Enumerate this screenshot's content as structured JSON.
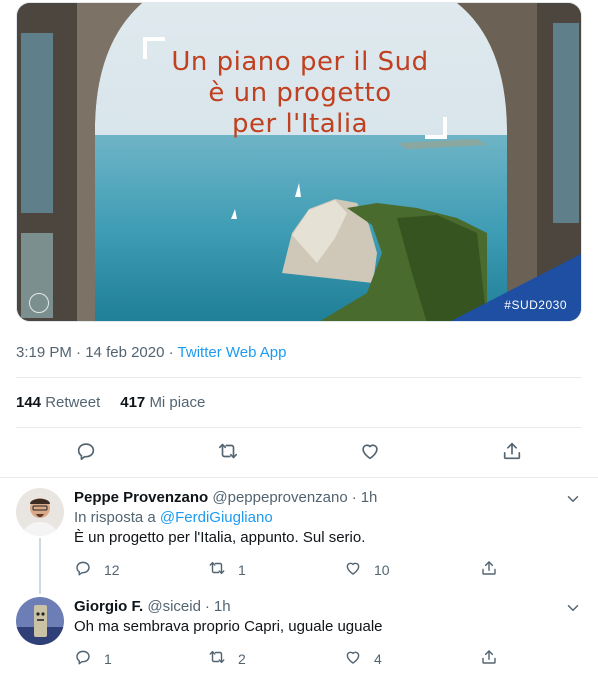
{
  "media": {
    "headline": [
      "Un piano per il Sud",
      "è un progetto",
      "per l'Italia"
    ],
    "hashtag": "#SUD2030"
  },
  "tweet": {
    "time": "3:19 PM",
    "dot": "·",
    "date": "14 feb 2020",
    "source": "Twitter Web App",
    "retweets": "144",
    "retweets_label": "Retweet",
    "likes": "417",
    "likes_label": "Mi piace"
  },
  "replies": [
    {
      "name": "Peppe Provenzano",
      "handle": "@peppeprovenzano",
      "dot": "·",
      "time": "1h",
      "in_reply_prefix": "In risposta a",
      "in_reply_mention": "@FerdiGiugliano",
      "text": "È un progetto per l'Italia, appunto. Sul serio.",
      "reply_count": "12",
      "retweet_count": "1",
      "like_count": "10"
    },
    {
      "name": "Giorgio F.",
      "handle": "@siceid",
      "dot": "·",
      "time": "1h",
      "text": "Oh ma sembrava proprio Capri, uguale uguale",
      "reply_count": "1",
      "retweet_count": "2",
      "like_count": "4"
    }
  ],
  "colors": {
    "accent": "#1d9bf0",
    "headline": "#c0401f",
    "corner": "#1e4fa3"
  },
  "icons": [
    "reply-icon",
    "retweet-icon",
    "like-icon",
    "share-icon",
    "chevron-down-icon"
  ]
}
